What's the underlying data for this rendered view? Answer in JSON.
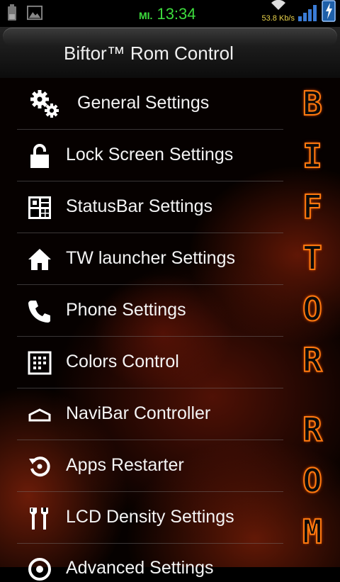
{
  "status_bar": {
    "day": "MI.",
    "time": "13:34",
    "speed": "53.8 Kb/s",
    "icons": [
      "battery-icon",
      "image-icon",
      "wifi-icon",
      "signal-icon",
      "power-icon"
    ]
  },
  "app": {
    "title": "Biftor™ Rom Control"
  },
  "menu": {
    "items": [
      {
        "label": "General Settings",
        "icon": "gears-icon"
      },
      {
        "label": "Lock Screen Settings",
        "icon": "lock-icon"
      },
      {
        "label": "StatusBar Settings",
        "icon": "statusbar-grid-icon"
      },
      {
        "label": "TW launcher Settings",
        "icon": "home-icon"
      },
      {
        "label": "Phone Settings",
        "icon": "phone-icon"
      },
      {
        "label": "Colors Control",
        "icon": "dialpad-icon"
      },
      {
        "label": "NaviBar Controller",
        "icon": "navibar-icon"
      },
      {
        "label": "Apps Restarter",
        "icon": "restart-icon"
      },
      {
        "label": "LCD Density Settings",
        "icon": "tools-icon"
      },
      {
        "label": "Advanced Settings",
        "icon": "advanced-icon"
      }
    ]
  },
  "side_logo": {
    "letters": [
      "B",
      "I",
      "F",
      "T",
      "O",
      "R",
      "R",
      "O",
      "M"
    ]
  },
  "colors": {
    "clock": "#3ddc3d",
    "speed": "#e8d24a",
    "side_outline": "#ff7a10",
    "text": "#f4f4f4"
  }
}
